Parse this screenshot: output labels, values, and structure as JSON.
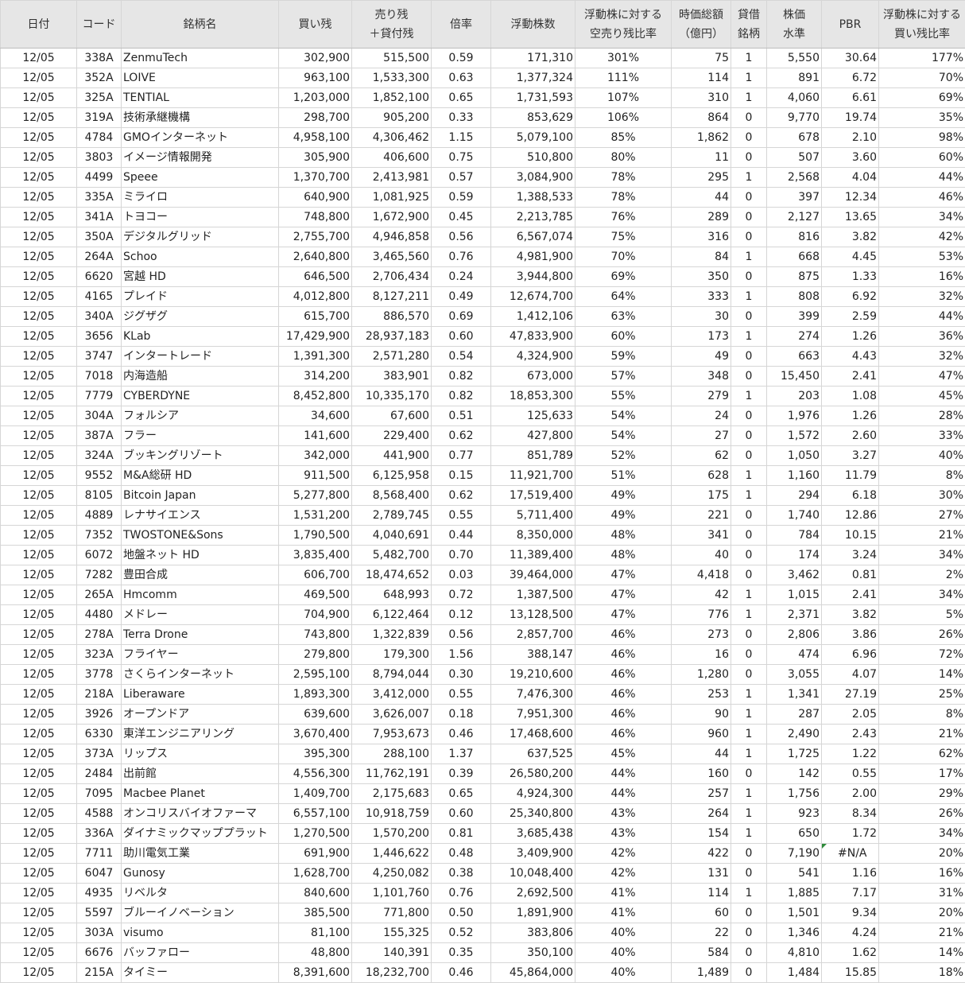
{
  "headers": [
    {
      "line1": "日付",
      "line2": ""
    },
    {
      "line1": "コード",
      "line2": ""
    },
    {
      "line1": "銘柄名",
      "line2": ""
    },
    {
      "line1": "買い残",
      "line2": ""
    },
    {
      "line1": "売り残",
      "line2": "＋貸付残"
    },
    {
      "line1": "倍率",
      "line2": ""
    },
    {
      "line1": "浮動株数",
      "line2": ""
    },
    {
      "line1": "浮動株に対する",
      "line2": "空売り残比率"
    },
    {
      "line1": "時価総額",
      "line2": "（億円）"
    },
    {
      "line1": "貸借",
      "line2": "銘柄"
    },
    {
      "line1": "株価",
      "line2": "水準"
    },
    {
      "line1": "PBR",
      "line2": ""
    },
    {
      "line1": "浮動株に対する",
      "line2": "買い残比率"
    }
  ],
  "rows": [
    [
      "12/05",
      "338A",
      "ZenmuTech",
      "302,900",
      "515,500",
      "0.59",
      "171,310",
      "301%",
      "75",
      "1",
      "5,550",
      "30.64",
      "177%"
    ],
    [
      "12/05",
      "352A",
      "LOIVE",
      "963,100",
      "1,533,300",
      "0.63",
      "1,377,324",
      "111%",
      "114",
      "1",
      "891",
      "6.72",
      "70%"
    ],
    [
      "12/05",
      "325A",
      "TENTIAL",
      "1,203,000",
      "1,852,100",
      "0.65",
      "1,731,593",
      "107%",
      "310",
      "1",
      "4,060",
      "6.61",
      "69%"
    ],
    [
      "12/05",
      "319A",
      "技術承継機構",
      "298,700",
      "905,200",
      "0.33",
      "853,629",
      "106%",
      "864",
      "0",
      "9,770",
      "19.74",
      "35%"
    ],
    [
      "12/05",
      "4784",
      "GMOインターネット",
      "4,958,100",
      "4,306,462",
      "1.15",
      "5,079,100",
      "85%",
      "1,862",
      "0",
      "678",
      "2.10",
      "98%"
    ],
    [
      "12/05",
      "3803",
      "イメージ情報開発",
      "305,900",
      "406,600",
      "0.75",
      "510,800",
      "80%",
      "11",
      "0",
      "507",
      "3.60",
      "60%"
    ],
    [
      "12/05",
      "4499",
      "Speee",
      "1,370,700",
      "2,413,981",
      "0.57",
      "3,084,900",
      "78%",
      "295",
      "1",
      "2,568",
      "4.04",
      "44%"
    ],
    [
      "12/05",
      "335A",
      "ミライロ",
      "640,900",
      "1,081,925",
      "0.59",
      "1,388,533",
      "78%",
      "44",
      "0",
      "397",
      "12.34",
      "46%"
    ],
    [
      "12/05",
      "341A",
      "トヨコー",
      "748,800",
      "1,672,900",
      "0.45",
      "2,213,785",
      "76%",
      "289",
      "0",
      "2,127",
      "13.65",
      "34%"
    ],
    [
      "12/05",
      "350A",
      "デジタルグリッド",
      "2,755,700",
      "4,946,858",
      "0.56",
      "6,567,074",
      "75%",
      "316",
      "0",
      "816",
      "3.82",
      "42%"
    ],
    [
      "12/05",
      "264A",
      "Schoo",
      "2,640,800",
      "3,465,560",
      "0.76",
      "4,981,900",
      "70%",
      "84",
      "1",
      "668",
      "4.45",
      "53%"
    ],
    [
      "12/05",
      "6620",
      "宮越 HD",
      "646,500",
      "2,706,434",
      "0.24",
      "3,944,800",
      "69%",
      "350",
      "0",
      "875",
      "1.33",
      "16%"
    ],
    [
      "12/05",
      "4165",
      "プレイド",
      "4,012,800",
      "8,127,211",
      "0.49",
      "12,674,700",
      "64%",
      "333",
      "1",
      "808",
      "6.92",
      "32%"
    ],
    [
      "12/05",
      "340A",
      "ジグザグ",
      "615,700",
      "886,570",
      "0.69",
      "1,412,106",
      "63%",
      "30",
      "0",
      "399",
      "2.59",
      "44%"
    ],
    [
      "12/05",
      "3656",
      "KLab",
      "17,429,900",
      "28,937,183",
      "0.60",
      "47,833,900",
      "60%",
      "173",
      "1",
      "274",
      "1.26",
      "36%"
    ],
    [
      "12/05",
      "3747",
      "インタートレード",
      "1,391,300",
      "2,571,280",
      "0.54",
      "4,324,900",
      "59%",
      "49",
      "0",
      "663",
      "4.43",
      "32%"
    ],
    [
      "12/05",
      "7018",
      "内海造船",
      "314,200",
      "383,901",
      "0.82",
      "673,000",
      "57%",
      "348",
      "0",
      "15,450",
      "2.41",
      "47%"
    ],
    [
      "12/05",
      "7779",
      "CYBERDYNE",
      "8,452,800",
      "10,335,170",
      "0.82",
      "18,853,300",
      "55%",
      "279",
      "1",
      "203",
      "1.08",
      "45%"
    ],
    [
      "12/05",
      "304A",
      "フォルシア",
      "34,600",
      "67,600",
      "0.51",
      "125,633",
      "54%",
      "24",
      "0",
      "1,976",
      "1.26",
      "28%"
    ],
    [
      "12/05",
      "387A",
      "フラー",
      "141,600",
      "229,400",
      "0.62",
      "427,800",
      "54%",
      "27",
      "0",
      "1,572",
      "2.60",
      "33%"
    ],
    [
      "12/05",
      "324A",
      "ブッキングリゾート",
      "342,000",
      "441,900",
      "0.77",
      "851,789",
      "52%",
      "62",
      "0",
      "1,050",
      "3.27",
      "40%"
    ],
    [
      "12/05",
      "9552",
      "M&A総研 HD",
      "911,500",
      "6,125,958",
      "0.15",
      "11,921,700",
      "51%",
      "628",
      "1",
      "1,160",
      "11.79",
      "8%"
    ],
    [
      "12/05",
      "8105",
      "Bitcoin Japan",
      "5,277,800",
      "8,568,400",
      "0.62",
      "17,519,400",
      "49%",
      "175",
      "1",
      "294",
      "6.18",
      "30%"
    ],
    [
      "12/05",
      "4889",
      "レナサイエンス",
      "1,531,200",
      "2,789,745",
      "0.55",
      "5,711,400",
      "49%",
      "221",
      "0",
      "1,740",
      "12.86",
      "27%"
    ],
    [
      "12/05",
      "7352",
      "TWOSTONE&Sons",
      "1,790,500",
      "4,040,691",
      "0.44",
      "8,350,000",
      "48%",
      "341",
      "0",
      "784",
      "10.15",
      "21%"
    ],
    [
      "12/05",
      "6072",
      "地盤ネット HD",
      "3,835,400",
      "5,482,700",
      "0.70",
      "11,389,400",
      "48%",
      "40",
      "0",
      "174",
      "3.24",
      "34%"
    ],
    [
      "12/05",
      "7282",
      "豊田合成",
      "606,700",
      "18,474,652",
      "0.03",
      "39,464,000",
      "47%",
      "4,418",
      "0",
      "3,462",
      "0.81",
      "2%"
    ],
    [
      "12/05",
      "265A",
      "Hmcomm",
      "469,500",
      "648,993",
      "0.72",
      "1,387,500",
      "47%",
      "42",
      "1",
      "1,015",
      "2.41",
      "34%"
    ],
    [
      "12/05",
      "4480",
      "メドレー",
      "704,900",
      "6,122,464",
      "0.12",
      "13,128,500",
      "47%",
      "776",
      "1",
      "2,371",
      "3.82",
      "5%"
    ],
    [
      "12/05",
      "278A",
      "Terra Drone",
      "743,800",
      "1,322,839",
      "0.56",
      "2,857,700",
      "46%",
      "273",
      "0",
      "2,806",
      "3.86",
      "26%"
    ],
    [
      "12/05",
      "323A",
      "フライヤー",
      "279,800",
      "179,300",
      "1.56",
      "388,147",
      "46%",
      "16",
      "0",
      "474",
      "6.96",
      "72%"
    ],
    [
      "12/05",
      "3778",
      "さくらインターネット",
      "2,595,100",
      "8,794,044",
      "0.30",
      "19,210,600",
      "46%",
      "1,280",
      "0",
      "3,055",
      "4.07",
      "14%"
    ],
    [
      "12/05",
      "218A",
      "Liberaware",
      "1,893,300",
      "3,412,000",
      "0.55",
      "7,476,300",
      "46%",
      "253",
      "1",
      "1,341",
      "27.19",
      "25%"
    ],
    [
      "12/05",
      "3926",
      "オープンドア",
      "639,600",
      "3,626,007",
      "0.18",
      "7,951,300",
      "46%",
      "90",
      "1",
      "287",
      "2.05",
      "8%"
    ],
    [
      "12/05",
      "6330",
      "東洋エンジニアリング",
      "3,670,400",
      "7,953,673",
      "0.46",
      "17,468,600",
      "46%",
      "960",
      "1",
      "2,490",
      "2.43",
      "21%"
    ],
    [
      "12/05",
      "373A",
      "リップス",
      "395,300",
      "288,100",
      "1.37",
      "637,525",
      "45%",
      "44",
      "1",
      "1,725",
      "1.22",
      "62%"
    ],
    [
      "12/05",
      "2484",
      "出前館",
      "4,556,300",
      "11,762,191",
      "0.39",
      "26,580,200",
      "44%",
      "160",
      "0",
      "142",
      "0.55",
      "17%"
    ],
    [
      "12/05",
      "7095",
      "Macbee Planet",
      "1,409,700",
      "2,175,683",
      "0.65",
      "4,924,300",
      "44%",
      "257",
      "1",
      "1,756",
      "2.00",
      "29%"
    ],
    [
      "12/05",
      "4588",
      "オンコリスバイオファーマ",
      "6,557,100",
      "10,918,759",
      "0.60",
      "25,340,800",
      "43%",
      "264",
      "1",
      "923",
      "8.34",
      "26%"
    ],
    [
      "12/05",
      "336A",
      "ダイナミックマッププラット",
      "1,270,500",
      "1,570,200",
      "0.81",
      "3,685,438",
      "43%",
      "154",
      "1",
      "650",
      "1.72",
      "34%"
    ],
    [
      "12/05",
      "7711",
      "助川電気工業",
      "691,900",
      "1,446,622",
      "0.48",
      "3,409,900",
      "42%",
      "422",
      "0",
      "7,190",
      "#N/A",
      "20%"
    ],
    [
      "12/05",
      "6047",
      "Gunosy",
      "1,628,700",
      "4,250,082",
      "0.38",
      "10,048,400",
      "42%",
      "131",
      "0",
      "541",
      "1.16",
      "16%"
    ],
    [
      "12/05",
      "4935",
      "リベルタ",
      "840,600",
      "1,101,760",
      "0.76",
      "2,692,500",
      "41%",
      "114",
      "1",
      "1,885",
      "7.17",
      "31%"
    ],
    [
      "12/05",
      "5597",
      "ブルーイノベーション",
      "385,500",
      "771,800",
      "0.50",
      "1,891,900",
      "41%",
      "60",
      "0",
      "1,501",
      "9.34",
      "20%"
    ],
    [
      "12/05",
      "303A",
      "visumo",
      "81,100",
      "155,325",
      "0.52",
      "383,806",
      "40%",
      "22",
      "0",
      "1,346",
      "4.24",
      "21%"
    ],
    [
      "12/05",
      "6676",
      "バッファロー",
      "48,800",
      "140,391",
      "0.35",
      "350,100",
      "40%",
      "584",
      "0",
      "4,810",
      "1.62",
      "14%"
    ],
    [
      "12/05",
      "215A",
      "タイミー",
      "8,391,600",
      "18,232,700",
      "0.46",
      "45,864,000",
      "40%",
      "1,489",
      "0",
      "1,484",
      "15.85",
      "18%"
    ]
  ],
  "colors": {
    "header_bg": "#e6e6e6",
    "grid_line": "#d6d6d6",
    "error_marker": "#2e8b3a"
  }
}
